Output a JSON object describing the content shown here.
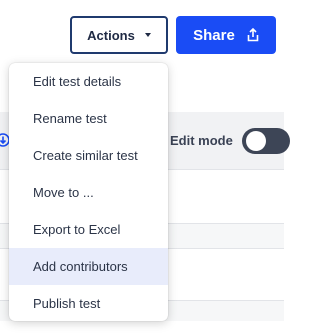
{
  "header": {
    "actions_label": "Actions",
    "share_label": "Share"
  },
  "toolbar": {
    "edit_mode_label": "Edit mode",
    "edit_mode_on": false
  },
  "actions_menu": {
    "items": [
      "Edit test details",
      "Rename test",
      "Create similar test",
      "Move to ...",
      "Export to Excel",
      "Add contributors",
      "Publish test"
    ],
    "highlighted_item": "Add contributors"
  },
  "colors": {
    "primary": "#1a4cf5",
    "outline": "#1f3a6e",
    "highlight": "#e8ecfb"
  }
}
